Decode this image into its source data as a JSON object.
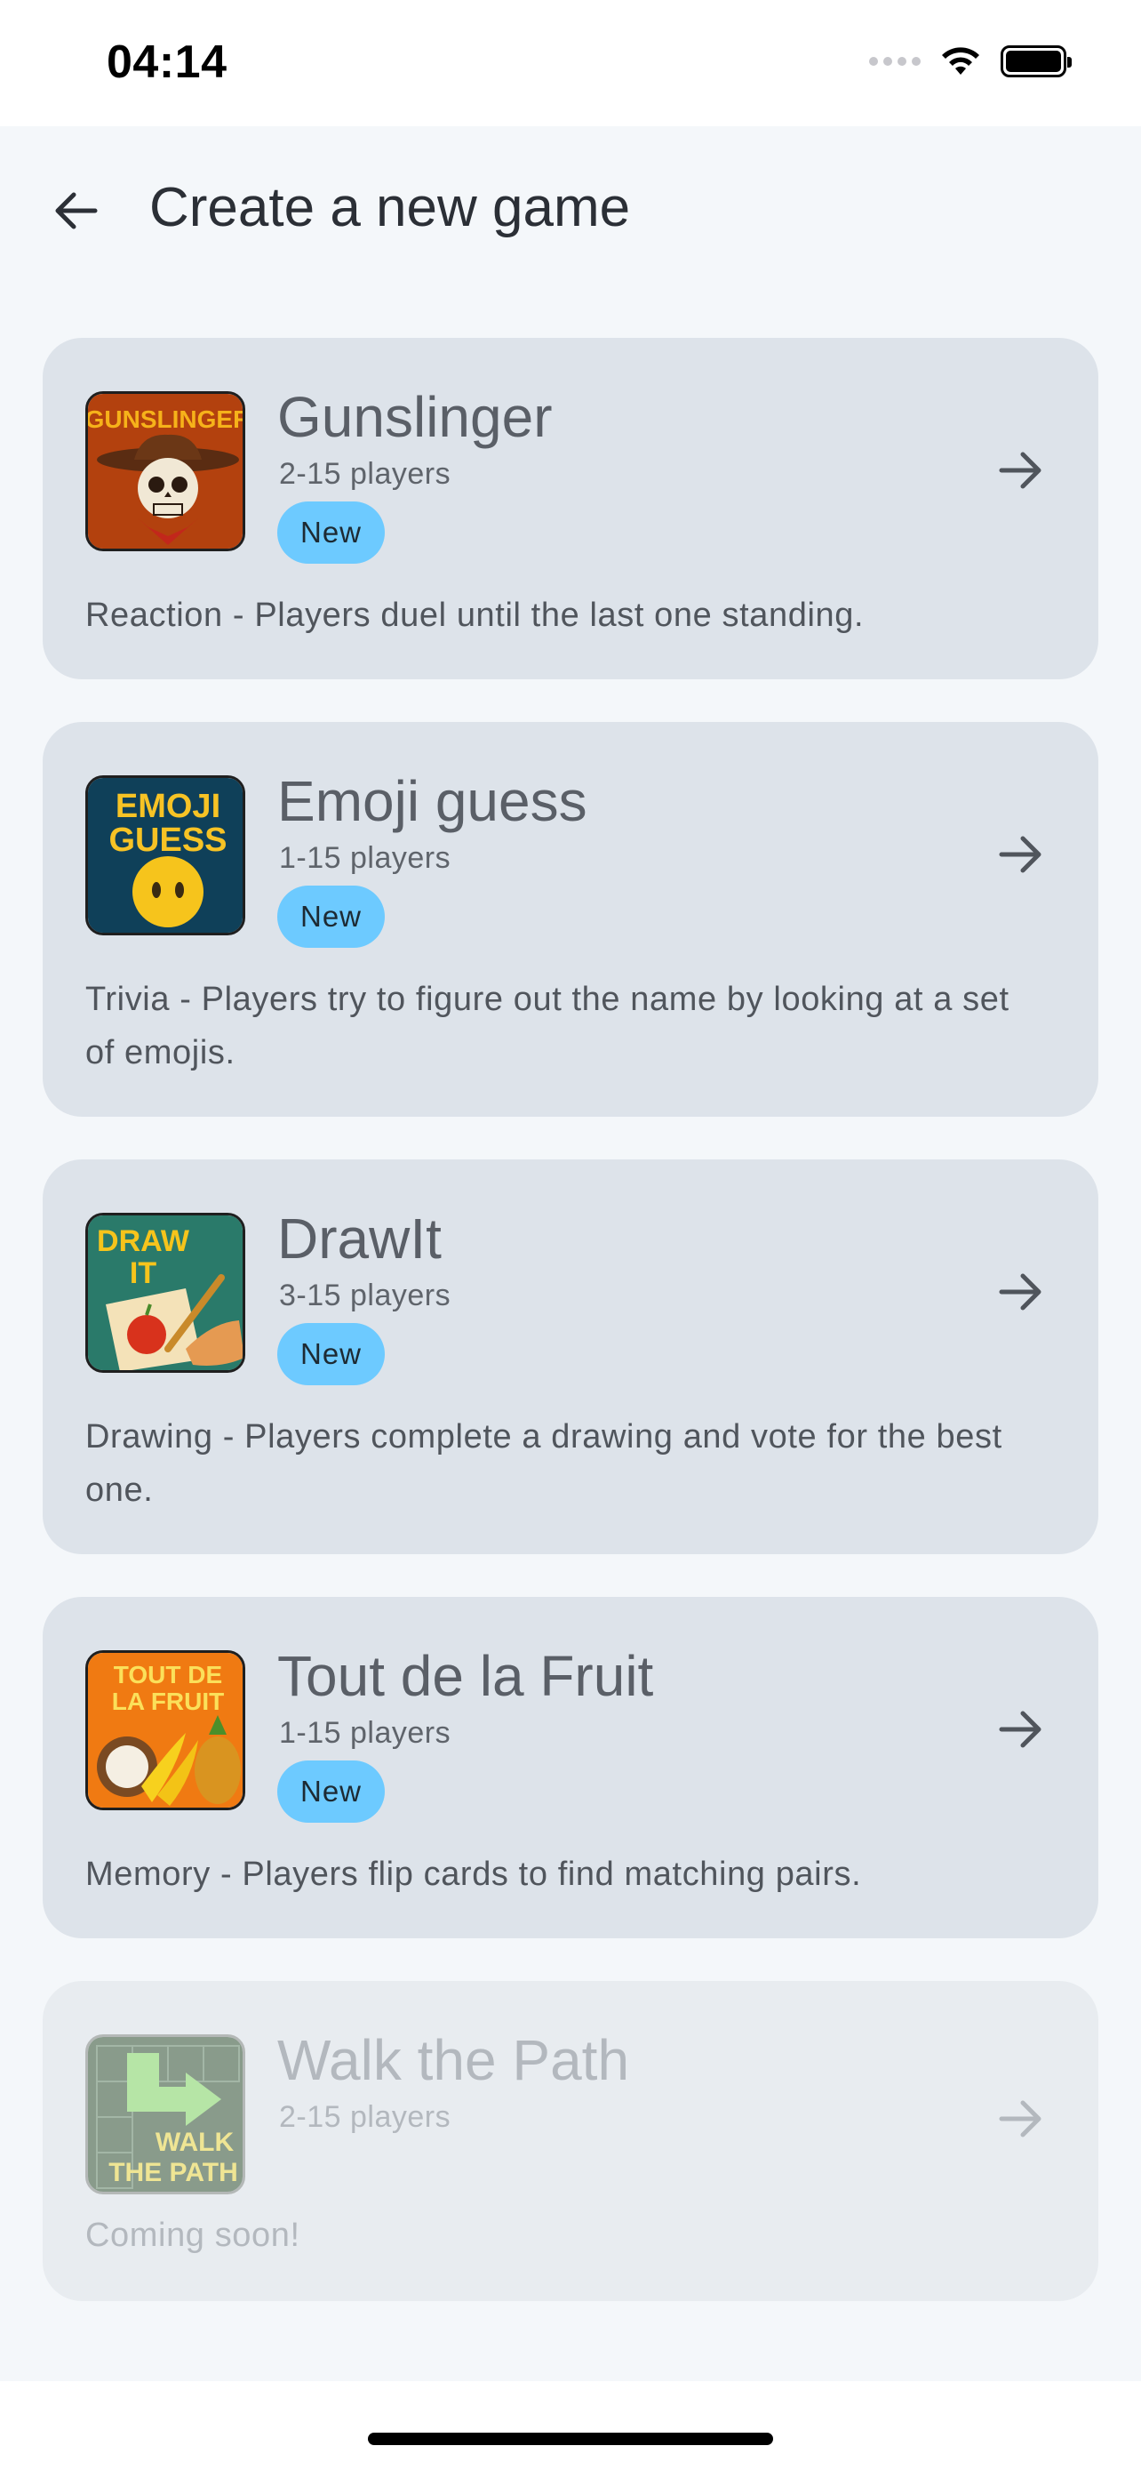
{
  "status_bar": {
    "time": "04:14"
  },
  "header": {
    "title": "Create a new game"
  },
  "games": [
    {
      "name": "Gunslinger",
      "players": "2-15 players",
      "badge": "New",
      "description": "Reaction - Players duel until the last one standing.",
      "thumb_text": "GUNSLINGER",
      "enabled": true
    },
    {
      "name": "Emoji guess",
      "players": "1-15 players",
      "badge": "New",
      "description": "Trivia - Players try to figure out the name by looking at a set of emojis.",
      "thumb_text_1": "EMOJI",
      "thumb_text_2": "GUESS",
      "enabled": true
    },
    {
      "name": "DrawIt",
      "players": "3-15 players",
      "badge": "New",
      "description": "Drawing - Players complete a drawing and vote for the best one.",
      "thumb_text_1": "DRAW",
      "thumb_text_2": "IT",
      "enabled": true
    },
    {
      "name": "Tout de la Fruit",
      "players": "1-15 players",
      "badge": "New",
      "description": "Memory - Players flip cards to find matching pairs.",
      "thumb_text_1": "TOUT DE",
      "thumb_text_2": "LA FRUIT",
      "enabled": true
    },
    {
      "name": "Walk the Path",
      "players": "2-15 players",
      "description": "Coming soon!",
      "thumb_text_1": "WALK",
      "thumb_text_2": "THE PATH",
      "enabled": false
    }
  ],
  "colors": {
    "background": "#f4f7fa",
    "card": "#dde3ea",
    "card_disabled": "#e8ecf0",
    "badge": "#6dcaff"
  },
  "icons": {
    "back": "arrow-left-icon",
    "card_action": "arrow-right-icon"
  }
}
